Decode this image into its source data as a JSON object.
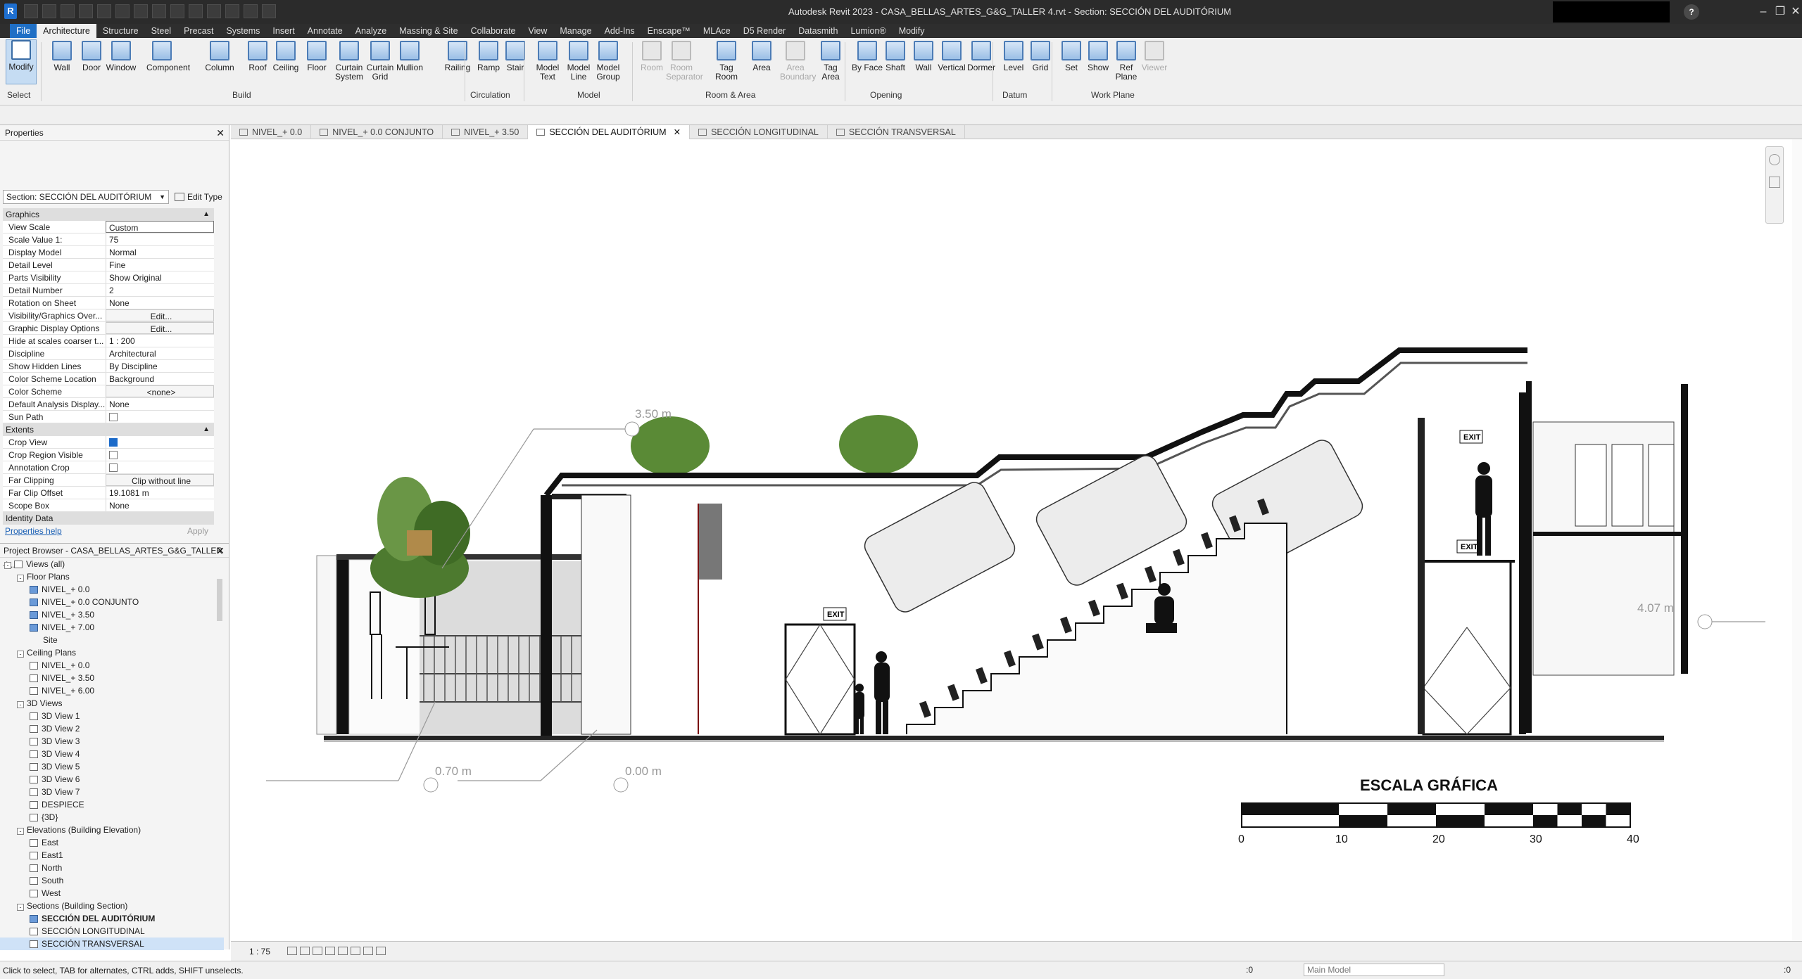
{
  "titlebar": {
    "title": "Autodesk Revit 2023 - CASA_BELLAS_ARTES_G&G_TALLER 4.rvt - Section: SECCIÓN DEL AUDITÓRIUM"
  },
  "menu": {
    "tabs": [
      "File",
      "Architecture",
      "Structure",
      "Steel",
      "Precast",
      "Systems",
      "Insert",
      "Annotate",
      "Analyze",
      "Massing & Site",
      "Collaborate",
      "View",
      "Manage",
      "Add-Ins",
      "Enscape™",
      "MLAce",
      "D5 Render",
      "Datasmith",
      "Lumion®",
      "Modify"
    ],
    "active": "Architecture"
  },
  "ribbon": {
    "tools": [
      {
        "label": "Modify",
        "icon": "cursor-icon"
      },
      {
        "label": "Wall",
        "icon": "wall-icon"
      },
      {
        "label": "Door",
        "icon": "door-icon"
      },
      {
        "label": "Window",
        "icon": "window-icon"
      },
      {
        "label": "Component",
        "icon": "component-icon"
      },
      {
        "label": "Column",
        "icon": "column-icon"
      },
      {
        "label": "Roof",
        "icon": "roof-icon"
      },
      {
        "label": "Ceiling",
        "icon": "ceiling-icon"
      },
      {
        "label": "Floor",
        "icon": "floor-icon"
      },
      {
        "label": "Curtain System",
        "icon": "curtain-system-icon"
      },
      {
        "label": "Curtain Grid",
        "icon": "curtain-grid-icon"
      },
      {
        "label": "Mullion",
        "icon": "mullion-icon"
      },
      {
        "label": "Railing",
        "icon": "railing-icon"
      },
      {
        "label": "Ramp",
        "icon": "ramp-icon"
      },
      {
        "label": "Stair",
        "icon": "stair-icon"
      },
      {
        "label": "Model Text",
        "icon": "model-text-icon"
      },
      {
        "label": "Model Line",
        "icon": "model-line-icon"
      },
      {
        "label": "Model Group",
        "icon": "model-group-icon"
      },
      {
        "label": "Room",
        "icon": "room-icon",
        "disabled": true
      },
      {
        "label": "Room Separator",
        "icon": "room-separator-icon",
        "disabled": true
      },
      {
        "label": "Tag Room",
        "icon": "tag-room-icon"
      },
      {
        "label": "Area",
        "icon": "area-icon"
      },
      {
        "label": "Area Boundary",
        "icon": "area-boundary-icon",
        "disabled": true
      },
      {
        "label": "Tag Area",
        "icon": "tag-area-icon"
      },
      {
        "label": "By Face",
        "icon": "by-face-icon"
      },
      {
        "label": "Shaft",
        "icon": "shaft-icon"
      },
      {
        "label": "Wall",
        "icon": "wall-opening-icon"
      },
      {
        "label": "Vertical",
        "icon": "vertical-opening-icon"
      },
      {
        "label": "Dormer",
        "icon": "dormer-icon"
      },
      {
        "label": "Level",
        "icon": "level-icon"
      },
      {
        "label": "Grid",
        "icon": "grid-icon"
      },
      {
        "label": "Set",
        "icon": "set-workplane-icon"
      },
      {
        "label": "Show",
        "icon": "show-workplane-icon"
      },
      {
        "label": "Ref Plane",
        "icon": "ref-plane-icon"
      },
      {
        "label": "Viewer",
        "icon": "viewer-icon",
        "disabled": true
      }
    ],
    "panels": [
      "Select",
      "Build",
      "Circulation",
      "Model",
      "Room & Area",
      "Opening",
      "Datum",
      "Work Plane"
    ]
  },
  "properties": {
    "header": "Properties",
    "type_selector": "Section: SECCIÓN DEL AUDITÓRIUM",
    "edit_type": "Edit Type",
    "sections": [
      {
        "name": "Graphics",
        "rows": [
          {
            "key": "View Scale",
            "value": "Custom",
            "style": "boxed"
          },
          {
            "key": "Scale Value    1:",
            "value": "75"
          },
          {
            "key": "Display Model",
            "value": "Normal"
          },
          {
            "key": "Detail Level",
            "value": "Fine"
          },
          {
            "key": "Parts Visibility",
            "value": "Show Original"
          },
          {
            "key": "Detail Number",
            "value": "2"
          },
          {
            "key": "Rotation on Sheet",
            "value": "None"
          },
          {
            "key": "Visibility/Graphics Over...",
            "value": "Edit...",
            "style": "button"
          },
          {
            "key": "Graphic Display Options",
            "value": "Edit...",
            "style": "button"
          },
          {
            "key": "Hide at scales coarser t...",
            "value": "1 : 200"
          },
          {
            "key": "Discipline",
            "value": "Architectural"
          },
          {
            "key": "Show Hidden Lines",
            "value": "By Discipline"
          },
          {
            "key": "Color Scheme Location",
            "value": "Background"
          },
          {
            "key": "Color Scheme",
            "value": "<none>",
            "style": "button"
          },
          {
            "key": "Default Analysis Display...",
            "value": "None"
          },
          {
            "key": "Sun Path",
            "value": "",
            "check": false
          }
        ]
      },
      {
        "name": "Extents",
        "rows": [
          {
            "key": "Crop View",
            "value": "",
            "check": true
          },
          {
            "key": "Crop Region Visible",
            "value": "",
            "check": false
          },
          {
            "key": "Annotation Crop",
            "value": "",
            "check": false
          },
          {
            "key": "Far Clipping",
            "value": "Clip without line",
            "style": "button"
          },
          {
            "key": "Far Clip Offset",
            "value": "19.1081 m"
          },
          {
            "key": "Scope Box",
            "value": "None"
          }
        ]
      },
      {
        "name": "Identity Data",
        "rows": []
      }
    ],
    "help_link": "Properties help",
    "apply": "Apply"
  },
  "browser": {
    "header": "Project Browser - CASA_BELLAS_ARTES_G&G_TALLER 4...",
    "items": [
      {
        "level": 0,
        "label": "Views (all)",
        "exp": "-",
        "icon": "views-icon"
      },
      {
        "level": 1,
        "label": "Floor Plans",
        "exp": "-"
      },
      {
        "level": 2,
        "label": "NIVEL_+ 0.0",
        "icon": "plan"
      },
      {
        "level": 2,
        "label": "NIVEL_+ 0.0 CONJUNTO",
        "icon": "plan"
      },
      {
        "level": 2,
        "label": "NIVEL_+ 3.50",
        "icon": "plan"
      },
      {
        "level": 2,
        "label": "NIVEL_+ 7.00",
        "icon": "plan"
      },
      {
        "level": 2,
        "label": "Site",
        "icon": "none"
      },
      {
        "level": 1,
        "label": "Ceiling Plans",
        "exp": "-"
      },
      {
        "level": 2,
        "label": "NIVEL_+ 0.0",
        "icon": "view"
      },
      {
        "level": 2,
        "label": "NIVEL_+ 3.50",
        "icon": "view"
      },
      {
        "level": 2,
        "label": "NIVEL_+ 6.00",
        "icon": "view"
      },
      {
        "level": 1,
        "label": "3D Views",
        "exp": "-"
      },
      {
        "level": 2,
        "label": "3D View 1",
        "icon": "view"
      },
      {
        "level": 2,
        "label": "3D View 2",
        "icon": "view"
      },
      {
        "level": 2,
        "label": "3D View 3",
        "icon": "view"
      },
      {
        "level": 2,
        "label": "3D View 4",
        "icon": "view"
      },
      {
        "level": 2,
        "label": "3D View 5",
        "icon": "view"
      },
      {
        "level": 2,
        "label": "3D View 6",
        "icon": "view"
      },
      {
        "level": 2,
        "label": "3D View 7",
        "icon": "view"
      },
      {
        "level": 2,
        "label": "DESPIECE",
        "icon": "view"
      },
      {
        "level": 2,
        "label": "{3D}",
        "icon": "view"
      },
      {
        "level": 1,
        "label": "Elevations (Building Elevation)",
        "exp": "-"
      },
      {
        "level": 2,
        "label": "East",
        "icon": "view"
      },
      {
        "level": 2,
        "label": "East1",
        "icon": "view"
      },
      {
        "level": 2,
        "label": "North",
        "icon": "view"
      },
      {
        "level": 2,
        "label": "South",
        "icon": "view"
      },
      {
        "level": 2,
        "label": "West",
        "icon": "view"
      },
      {
        "level": 1,
        "label": "Sections (Building Section)",
        "exp": "-"
      },
      {
        "level": 2,
        "label": "SECCIÓN DEL AUDITÓRIUM",
        "icon": "plan",
        "bold": true
      },
      {
        "level": 2,
        "label": "SECCIÓN LONGITUDINAL",
        "icon": "view"
      },
      {
        "level": 2,
        "label": "SECCIÓN TRANSVERSAL",
        "icon": "view",
        "selected": true
      }
    ]
  },
  "viewtabs": [
    {
      "label": "NIVEL_+ 0.0"
    },
    {
      "label": "NIVEL_+ 0.0 CONJUNTO"
    },
    {
      "label": "NIVEL_+ 3.50"
    },
    {
      "label": "SECCIÓN DEL AUDITÓRIUM",
      "active": true
    },
    {
      "label": "SECCIÓN LONGITUDINAL"
    },
    {
      "label": "SECCIÓN TRANSVERSAL"
    }
  ],
  "drawing": {
    "levels": [
      {
        "label": "3.50 m"
      },
      {
        "label": "4.07 m"
      },
      {
        "label": "0.70 m"
      },
      {
        "label": "0.00 m"
      }
    ],
    "exit_signs": [
      "EXIT",
      "EXIT",
      "EXIT"
    ],
    "scale_title": "ESCALA GRÁFICA",
    "scale_ticks": [
      "0",
      "10",
      "20",
      "30",
      "40"
    ]
  },
  "viewcontrol": {
    "scale": "1 : 75"
  },
  "status": {
    "message": "Click to select, TAB for alternates, CTRL adds, SHIFT unselects.",
    "model": "Main Model",
    "zero1": ":0",
    "zero2": ":0"
  },
  "colors": {
    "accent": "#1f6fc5",
    "titlebar": "#2b2b2b",
    "ribbon": "#f0f0f0"
  }
}
